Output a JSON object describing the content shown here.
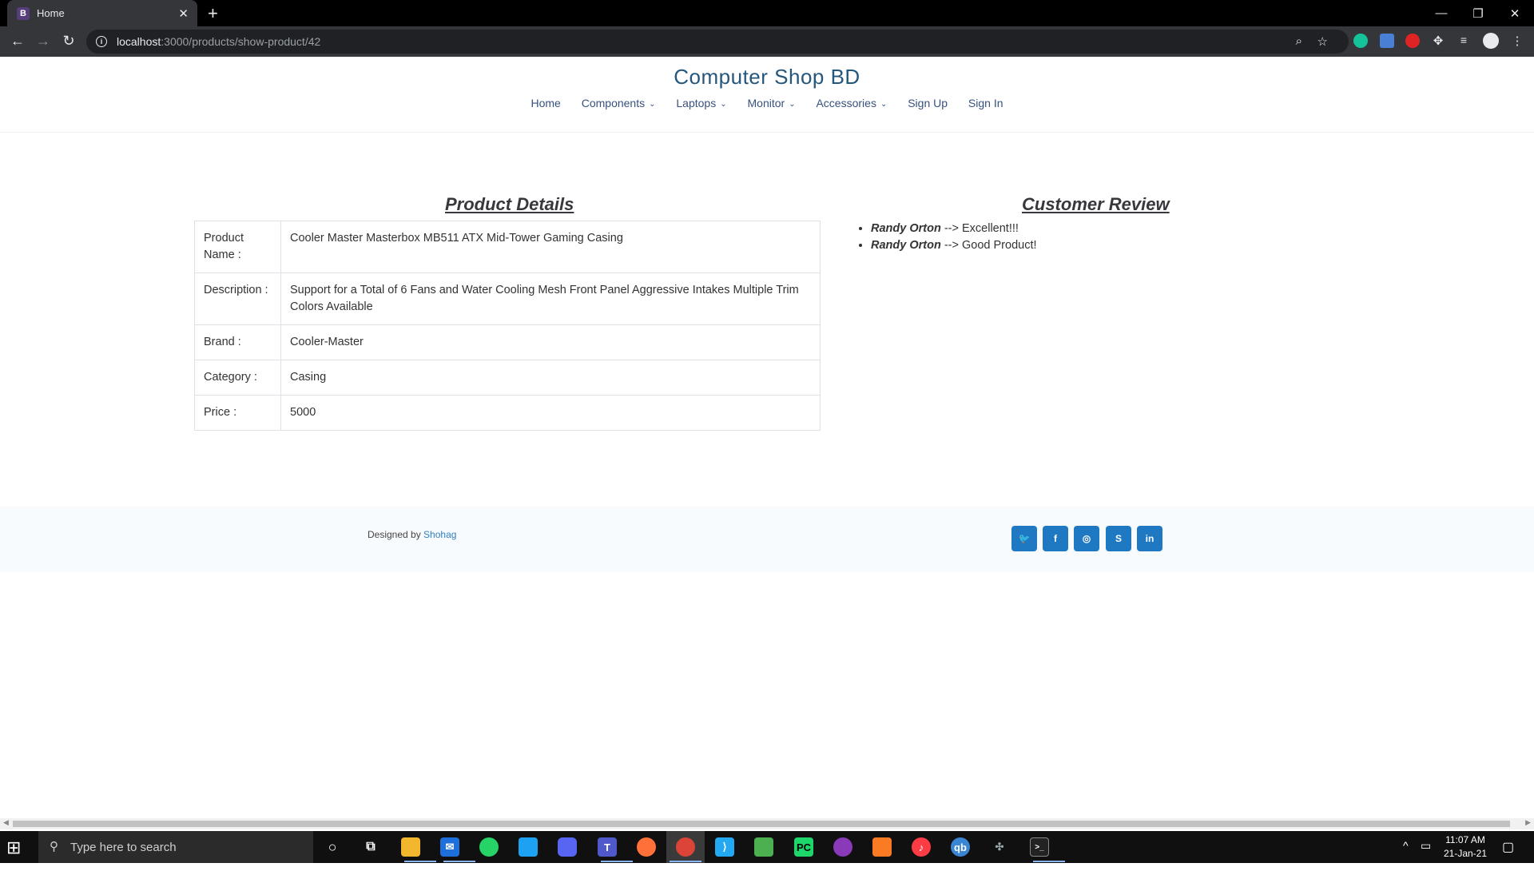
{
  "browser": {
    "tab_title": "Home",
    "tab_favicon": "B",
    "url_host": "localhost",
    "url_path": ":3000/products/show-product/42"
  },
  "site": {
    "brand": "Computer Shop BD",
    "nav": [
      {
        "label": "Home",
        "dropdown": false
      },
      {
        "label": "Components",
        "dropdown": true
      },
      {
        "label": "Laptops",
        "dropdown": true
      },
      {
        "label": "Monitor",
        "dropdown": true
      },
      {
        "label": "Accessories",
        "dropdown": true
      },
      {
        "label": "Sign Up",
        "dropdown": false
      },
      {
        "label": "Sign In",
        "dropdown": false
      }
    ]
  },
  "product": {
    "heading": "Product Details",
    "rows": [
      {
        "label": "Product Name :",
        "value": "Cooler Master Masterbox MB511 ATX Mid-Tower Gaming Casing"
      },
      {
        "label": "Description :",
        "value": "Support for a Total of 6 Fans and Water Cooling Mesh Front Panel Aggressive Intakes Multiple Trim Colors Available"
      },
      {
        "label": "Brand :",
        "value": "Cooler-Master"
      },
      {
        "label": "Category :",
        "value": "Casing"
      },
      {
        "label": "Price :",
        "value": "5000"
      }
    ]
  },
  "reviews": {
    "heading": "Customer Review",
    "items": [
      {
        "name": "Randy Orton",
        "sep": " --> ",
        "text": "Excellent!!!"
      },
      {
        "name": "Randy Orton",
        "sep": " --> ",
        "text": "Good Product!"
      }
    ]
  },
  "footer": {
    "designed_prefix": "Designed by ",
    "designer": "Shohag",
    "social": [
      {
        "icon": "twitter-icon",
        "glyph": "🐦"
      },
      {
        "icon": "facebook-icon",
        "glyph": "f"
      },
      {
        "icon": "instagram-icon",
        "glyph": "◎"
      },
      {
        "icon": "skype-icon",
        "glyph": "S"
      },
      {
        "icon": "linkedin-icon",
        "glyph": "in"
      }
    ]
  },
  "taskbar": {
    "search_placeholder": "Type here to search",
    "time": "11:07 AM",
    "date": "21-Jan-21"
  },
  "colors": {
    "brand": "#25577c",
    "social_bg": "#1f79c2"
  }
}
